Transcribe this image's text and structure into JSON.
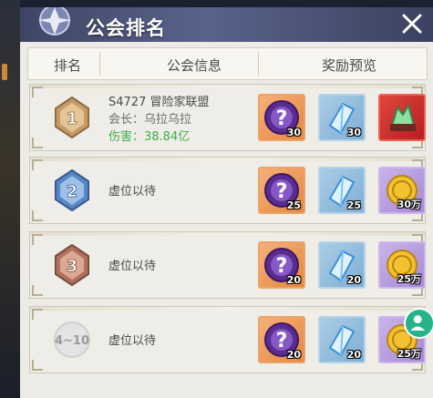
{
  "title": "公会排名",
  "columns": {
    "rank": "排名",
    "info": "公会信息",
    "rewards": "奖励预览"
  },
  "rows": [
    {
      "rank_label": "1",
      "rank_color": "#b88a5a",
      "guild_name": "S4727 冒险家联盟",
      "leader": "会长：乌拉乌拉",
      "damage": "伤害：38.84亿",
      "vacant": "",
      "rewards": [
        {
          "qty": "30"
        },
        {
          "qty": "30"
        },
        {
          "qty": ""
        }
      ]
    },
    {
      "rank_label": "2",
      "rank_color": "#5b86c4",
      "guild_name": "",
      "leader": "",
      "damage": "",
      "vacant": "虚位以待",
      "rewards": [
        {
          "qty": "25"
        },
        {
          "qty": "25"
        },
        {
          "qty": "30万"
        }
      ]
    },
    {
      "rank_label": "3",
      "rank_color": "#b0715e",
      "guild_name": "",
      "leader": "",
      "damage": "",
      "vacant": "虚位以待",
      "rewards": [
        {
          "qty": "20"
        },
        {
          "qty": "20"
        },
        {
          "qty": "25万"
        }
      ]
    },
    {
      "rank_label": "4~10",
      "rank_color": "#bdbdbd",
      "guild_name": "",
      "leader": "",
      "damage": "",
      "vacant": "虚位以待",
      "rewards": [
        {
          "qty": "20"
        },
        {
          "qty": "20"
        },
        {
          "qty": "25万"
        }
      ]
    }
  ],
  "icons": {
    "close": "close-icon",
    "mystery": "mystery-orb-icon",
    "crystal": "crystal-icon",
    "coin": "gold-coin-icon",
    "chest": "green-crystal-chest-icon",
    "assistant": "assistant-icon"
  },
  "colors": {
    "damage": "#3fae4a",
    "title_bar": "#59638a"
  }
}
